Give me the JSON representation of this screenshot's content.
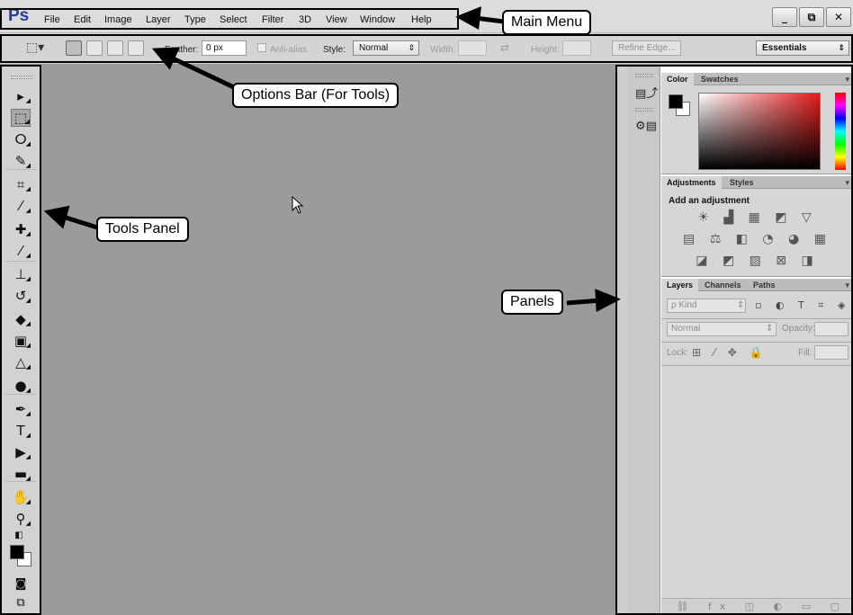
{
  "app": {
    "logo": "Ps"
  },
  "menu": [
    "File",
    "Edit",
    "Image",
    "Layer",
    "Type",
    "Select",
    "Filter",
    "3D",
    "View",
    "Window",
    "Help"
  ],
  "window_controls": {
    "minimize": "_",
    "restore": "⧉",
    "close": "✕"
  },
  "options_bar": {
    "feather_label": "Feather:",
    "feather_value": "0 px",
    "antialias_label": "Anti-alias",
    "style_label": "Style:",
    "style_value": "Normal",
    "width_label": "Width:",
    "height_label": "Height:",
    "refine_edge": "Refine Edge...",
    "workspace": "Essentials"
  },
  "tools": [
    {
      "name": "move-tool",
      "icon": "move-icon",
      "glyph": "▸"
    },
    {
      "name": "marquee-tool",
      "icon": "rectangular-marquee-icon",
      "glyph": "⬚"
    },
    {
      "name": "lasso-tool",
      "icon": "lasso-icon",
      "glyph": "ⵔ"
    },
    {
      "name": "quick-selection-tool",
      "icon": "quick-selection-icon",
      "glyph": "✎"
    },
    {
      "name": "crop-tool",
      "icon": "crop-icon",
      "glyph": "⌗"
    },
    {
      "name": "eyedropper-tool",
      "icon": "eyedropper-icon",
      "glyph": "⁄"
    },
    {
      "name": "healing-brush-tool",
      "icon": "healing-brush-icon",
      "glyph": "✚"
    },
    {
      "name": "brush-tool",
      "icon": "brush-icon",
      "glyph": "⁄"
    },
    {
      "name": "clone-stamp-tool",
      "icon": "clone-stamp-icon",
      "glyph": "⊥"
    },
    {
      "name": "history-brush-tool",
      "icon": "history-brush-icon",
      "glyph": "↺"
    },
    {
      "name": "eraser-tool",
      "icon": "eraser-icon",
      "glyph": "◆"
    },
    {
      "name": "gradient-tool",
      "icon": "gradient-icon",
      "glyph": "▣"
    },
    {
      "name": "blur-tool",
      "icon": "blur-icon",
      "glyph": "△"
    },
    {
      "name": "dodge-tool",
      "icon": "dodge-icon",
      "glyph": "●"
    },
    {
      "name": "pen-tool",
      "icon": "pen-icon",
      "glyph": "✒"
    },
    {
      "name": "type-tool",
      "icon": "type-icon",
      "glyph": "T"
    },
    {
      "name": "path-selection-tool",
      "icon": "path-selection-icon",
      "glyph": "▶"
    },
    {
      "name": "rectangle-tool",
      "icon": "rectangle-shape-icon",
      "glyph": "▬"
    },
    {
      "name": "hand-tool",
      "icon": "hand-icon",
      "glyph": "✋"
    },
    {
      "name": "zoom-tool",
      "icon": "zoom-icon",
      "glyph": "⚲"
    }
  ],
  "panels": {
    "color_tabs": [
      "Color",
      "Swatches"
    ],
    "adjustment_tabs": [
      "Adjustments",
      "Styles"
    ],
    "adjustment_title": "Add an adjustment",
    "adjustment_icon_rows": [
      "☀ ▟ ▦ ◩ ▽",
      "▤ ⚖ ◧ ◔ ◕ ▦",
      "◪ ◩ ▨ ⊠ ◨"
    ],
    "layers_tabs": [
      "Layers",
      "Channels",
      "Paths"
    ],
    "layers_kind": "ρ Kind",
    "layers_kind_icons": "▫ ◐ T ⌗ ◈",
    "blend_mode": "Normal",
    "opacity_label": "Opacity:",
    "lock_label": "Lock:",
    "lock_icons": "⊞ ⁄ ✥ 🔒",
    "fill_label": "Fill:",
    "footer_icons": "⛓ fx ◫ ◐ ▭ ▢ 🗑"
  },
  "callouts": {
    "main_menu": "Main Menu",
    "options_bar": "Options Bar (For Tools)",
    "tools_panel": "Tools Panel",
    "panels": "Panels"
  }
}
